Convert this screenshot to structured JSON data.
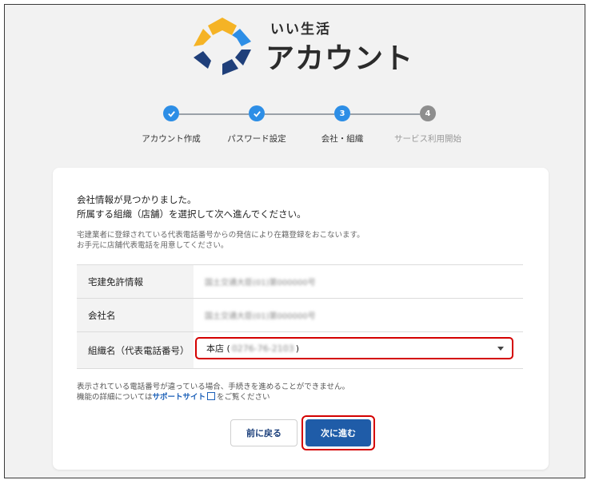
{
  "brand": {
    "line1": "いい生活",
    "line2": "アカウント",
    "logo_colors": [
      "#f5b325",
      "#2d8ee6",
      "#1f3f7a"
    ]
  },
  "stepper": {
    "steps": [
      {
        "label": "アカウント作成",
        "state": "done",
        "icon": "check-icon"
      },
      {
        "label": "パスワード設定",
        "state": "done",
        "icon": "check-icon"
      },
      {
        "label": "会社・組織",
        "state": "current",
        "number": "3"
      },
      {
        "label": "サービス利用開始",
        "state": "todo",
        "number": "4"
      }
    ]
  },
  "card": {
    "message_line1": "会社情報が見つかりました。",
    "message_line2": "所属する組織（店舗）を選択して次へ進んでください。",
    "note_line1": "宅建業者に登録されている代表電話番号からの発信により在籍登録をおこないます。",
    "note_line2": "お手元に店舗代表電話を用意してください。",
    "table": {
      "license_label": "宅建免許情報",
      "license_value": "国土交通大臣(01)第000000号",
      "company_label": "会社名",
      "company_value": "国土交通大臣(01)第000000号",
      "org_label": "組織名（代表電話番号）"
    },
    "select": {
      "store": "本店 (",
      "phone": "0276-76-2103",
      "close": ")"
    },
    "warning_line1": "表示されている電話番号が違っている場合、手続きを進めることができません。",
    "warning_prefix": "機能の詳細については",
    "support_link": "サポートサイト",
    "warning_suffix": "をご覧ください",
    "back_button": "前に戻る",
    "next_button": "次に進む"
  },
  "colors": {
    "accent": "#2d8ee6",
    "primary_button": "#1f5ca8",
    "highlight": "#d40000"
  }
}
